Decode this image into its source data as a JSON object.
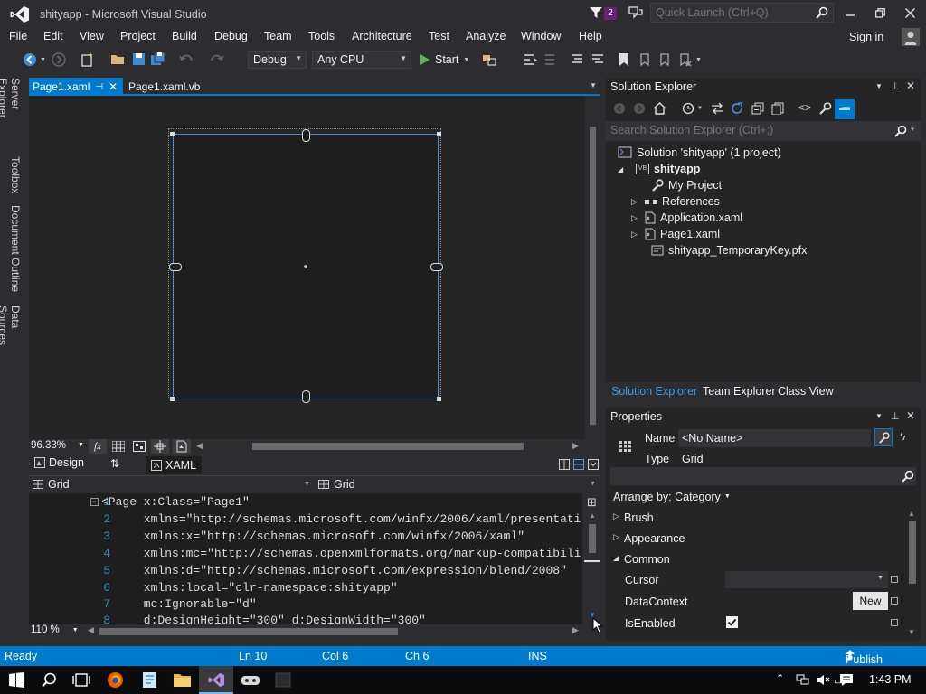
{
  "window": {
    "title": "shityapp - Microsoft Visual Studio",
    "notification_count": "2",
    "quick_launch_placeholder": "Quick Launch (Ctrl+Q)"
  },
  "menu": {
    "items": [
      "File",
      "Edit",
      "View",
      "Project",
      "Build",
      "Debug",
      "Team",
      "Tools",
      "Architecture",
      "Test",
      "Analyze",
      "Window",
      "Help"
    ],
    "sign_in": "Sign in"
  },
  "toolbar": {
    "config": "Debug",
    "platform": "Any CPU",
    "start": "Start"
  },
  "side_tabs": [
    "Server Explorer",
    "Toolbox",
    "Document Outline",
    "Data Sources"
  ],
  "doc_tabs": [
    {
      "label": "Page1.xaml",
      "active": true
    },
    {
      "label": "Page1.xaml.vb",
      "active": false
    }
  ],
  "designer": {
    "zoom": "96.33%",
    "fx": "fx",
    "view_design": "Design",
    "view_xaml": "XAML",
    "breadcrumb_left": "Grid",
    "breadcrumb_right": "Grid"
  },
  "code": {
    "lines": [
      {
        "num": "1",
        "text": "<Page x:Class=\"Page1\""
      },
      {
        "num": "2",
        "text": "      xmlns=\"http://schemas.microsoft.com/winfx/2006/xaml/presentati"
      },
      {
        "num": "3",
        "text": "      xmlns:x=\"http://schemas.microsoft.com/winfx/2006/xaml\""
      },
      {
        "num": "4",
        "text": "      xmlns:mc=\"http://schemas.openxmlformats.org/markup-compatibili"
      },
      {
        "num": "5",
        "text": "      xmlns:d=\"http://schemas.microsoft.com/expression/blend/2008\""
      },
      {
        "num": "6",
        "text": "      xmlns:local=\"clr-namespace:shityapp\""
      },
      {
        "num": "7",
        "text": "      mc:Ignorable=\"d\""
      },
      {
        "num": "8",
        "text": "      d:DesignHeight=\"300\" d:DesignWidth=\"300\""
      }
    ],
    "zoom": "110 %"
  },
  "solution_explorer": {
    "title": "Solution Explorer",
    "search_placeholder": "Search Solution Explorer (Ctrl+;)",
    "solution": "Solution 'shityapp' (1 project)",
    "project": "shityapp",
    "project_badge": "VB",
    "items": [
      "My Project",
      "References",
      "Application.xaml",
      "Page1.xaml",
      "shityapp_TemporaryKey.pfx"
    ],
    "bottom_tabs": [
      "Solution Explorer",
      "Team Explorer",
      "Class View"
    ]
  },
  "properties": {
    "title": "Properties",
    "name_label": "Name",
    "name_value": "<No Name>",
    "type_label": "Type",
    "type_value": "Grid",
    "arrange_by": "Arrange by: Category",
    "categories": [
      "Brush",
      "Appearance",
      "Common"
    ],
    "props": [
      "Cursor",
      "DataContext",
      "IsEnabled"
    ],
    "new_button": "New"
  },
  "status": {
    "ready": "Ready",
    "ln": "Ln 10",
    "col": "Col 6",
    "ch": "Ch 6",
    "ins": "INS",
    "publish": "Publish"
  },
  "taskbar": {
    "time": "1:43 PM"
  },
  "colors": {
    "accent": "#007acc",
    "bg": "#2d2d30",
    "panel": "#252526",
    "editor": "#1e1e1e",
    "vs_purple": "#865fc5"
  }
}
